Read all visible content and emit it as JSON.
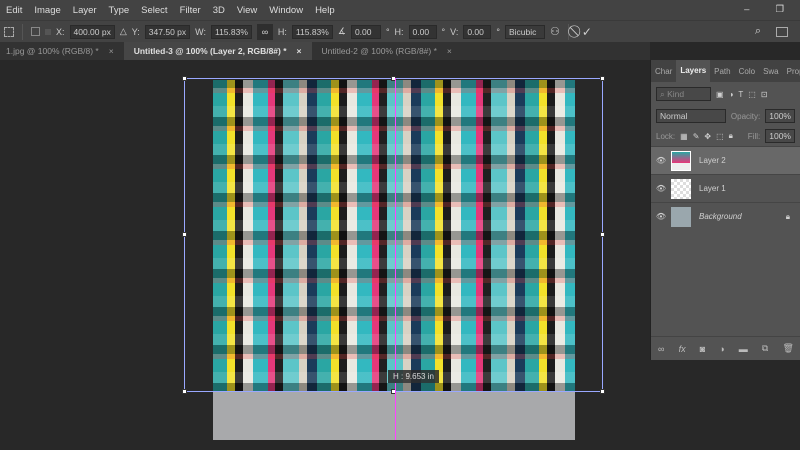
{
  "menu": [
    "Edit",
    "Image",
    "Layer",
    "Type",
    "Select",
    "Filter",
    "3D",
    "View",
    "Window",
    "Help"
  ],
  "options": {
    "x_label": "X:",
    "x": "400.00 px",
    "y_label": "Y:",
    "y": "347.50 px",
    "w_label": "W:",
    "w": "115.83%",
    "h_label": "H:",
    "h": "115.83%",
    "angle": "0.00",
    "deg": "°",
    "hskew_label": "H:",
    "hskew": "0.00",
    "vskew_label": "V:",
    "vskew": "0.00",
    "interp": "Bicubic"
  },
  "tabs": [
    {
      "label": "1.jpg @ 100% (RGB/8) *"
    },
    {
      "label": "Untitled-3 @ 100% (Layer 2, RGB/8#) *"
    },
    {
      "label": "Untitled-2 @ 100% (RGB/8#) *"
    }
  ],
  "close": "×",
  "readout": "H : 9.653 in",
  "panel": {
    "tabs": [
      "Char",
      "Layers",
      "Path",
      "Colo",
      "Swa",
      "Prop"
    ],
    "kind": "Kind",
    "blend": "Normal",
    "opacity_label": "Opacity:",
    "opacity": "100%",
    "lock_label": "Lock:",
    "fill_label": "Fill:",
    "fill": "100%",
    "layers": [
      {
        "name": "Layer 2",
        "selected": true
      },
      {
        "name": "Layer 1"
      },
      {
        "name": "Background",
        "locked": true
      }
    ]
  }
}
